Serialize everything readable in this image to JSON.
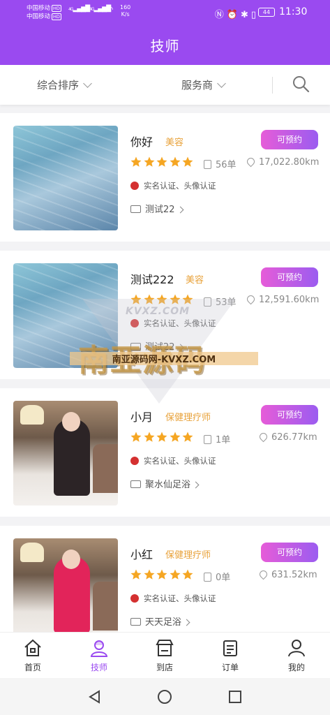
{
  "status_bar": {
    "carrier1": "中国移动",
    "carrier2": "中国移动",
    "hd": "HD",
    "net": "4G",
    "speed_value": "160",
    "speed_unit": "K/s",
    "battery": "44",
    "time": "11:30"
  },
  "header": {
    "title": "技师"
  },
  "filters": {
    "sort_label": "综合排序",
    "provider_label": "服务商"
  },
  "technicians": [
    {
      "name": "你好",
      "category": "美容",
      "book_label": "可预约",
      "rating": 5,
      "orders": "56单",
      "distance": "17,022.80km",
      "verify": "实名认证、头像认证",
      "shop": "测试22"
    },
    {
      "name": "测试222",
      "category": "美容",
      "book_label": "可预约",
      "rating": 5,
      "orders": "53单",
      "distance": "12,591.60km",
      "verify": "实名认证、头像认证",
      "shop": "测试22"
    },
    {
      "name": "小月",
      "category": "保健理疗师",
      "book_label": "可预约",
      "rating": 5,
      "orders": "1单",
      "distance": "626.77km",
      "verify": "实名认证、头像认证",
      "shop": "聚水仙足浴"
    },
    {
      "name": "小红",
      "category": "保健理疗师",
      "book_label": "可预约",
      "rating": 5,
      "orders": "0单",
      "distance": "631.52km",
      "verify": "实名认证、头像认证",
      "shop": "天天足浴"
    }
  ],
  "watermark": {
    "top": "KVXZ.COM",
    "big": "南亚源码",
    "url": "南亚源码网-KVXZ.COM"
  },
  "tabs": [
    {
      "label": "首页",
      "icon": "home-icon"
    },
    {
      "label": "技师",
      "icon": "technician-icon",
      "active": true
    },
    {
      "label": "到店",
      "icon": "store-icon"
    },
    {
      "label": "订单",
      "icon": "order-icon"
    },
    {
      "label": "我的",
      "icon": "profile-icon"
    }
  ],
  "colors": {
    "brand": "#9a4af0",
    "category": "#e8a23a",
    "star": "#f5a623",
    "book_gradient_start": "#e65cd8",
    "book_gradient_end": "#9b5cf0"
  }
}
